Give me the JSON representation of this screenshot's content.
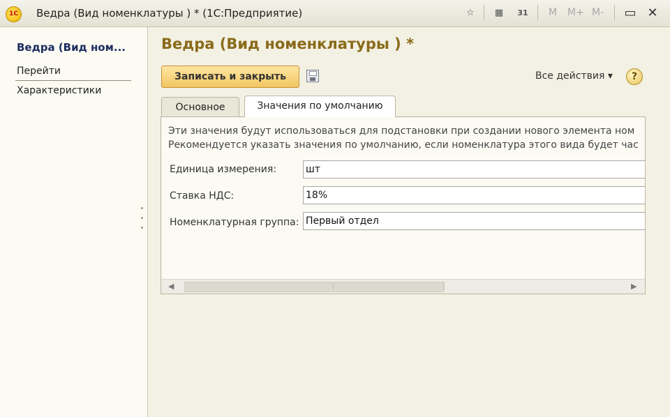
{
  "window": {
    "logo_text": "1С",
    "title": "Ведра (Вид номенклатуры ) * (1С:Предприятие)",
    "toolbar": {
      "calendar_text": "31",
      "m_label": "M",
      "m_plus_label": "M+",
      "m_minus_label": "M-"
    }
  },
  "sidebar": {
    "title": "Ведра (Вид ном...",
    "items": [
      {
        "label": "Перейти"
      },
      {
        "label": "Характеристики"
      }
    ]
  },
  "form": {
    "title": "Ведра (Вид номенклатуры ) *",
    "save_close_label": "Записать и закрыть",
    "all_actions_label": "Все действия ▾",
    "help_label": "?",
    "tabs": [
      {
        "label": "Основное",
        "active": false
      },
      {
        "label": "Значения по умолчанию",
        "active": true
      }
    ],
    "info": [
      "Эти значения будут использоваться для подстановки при создании нового элемента ном",
      "Рекомендуется указать значения по умолчанию, если номенклатура этого вида будет час"
    ],
    "fields": [
      {
        "label": "Единица измерения:",
        "value": "шт"
      },
      {
        "label": "Ставка НДС:",
        "value": "18%"
      },
      {
        "label": "Номенклатурная группа:",
        "value": "Первый отдел"
      }
    ]
  }
}
